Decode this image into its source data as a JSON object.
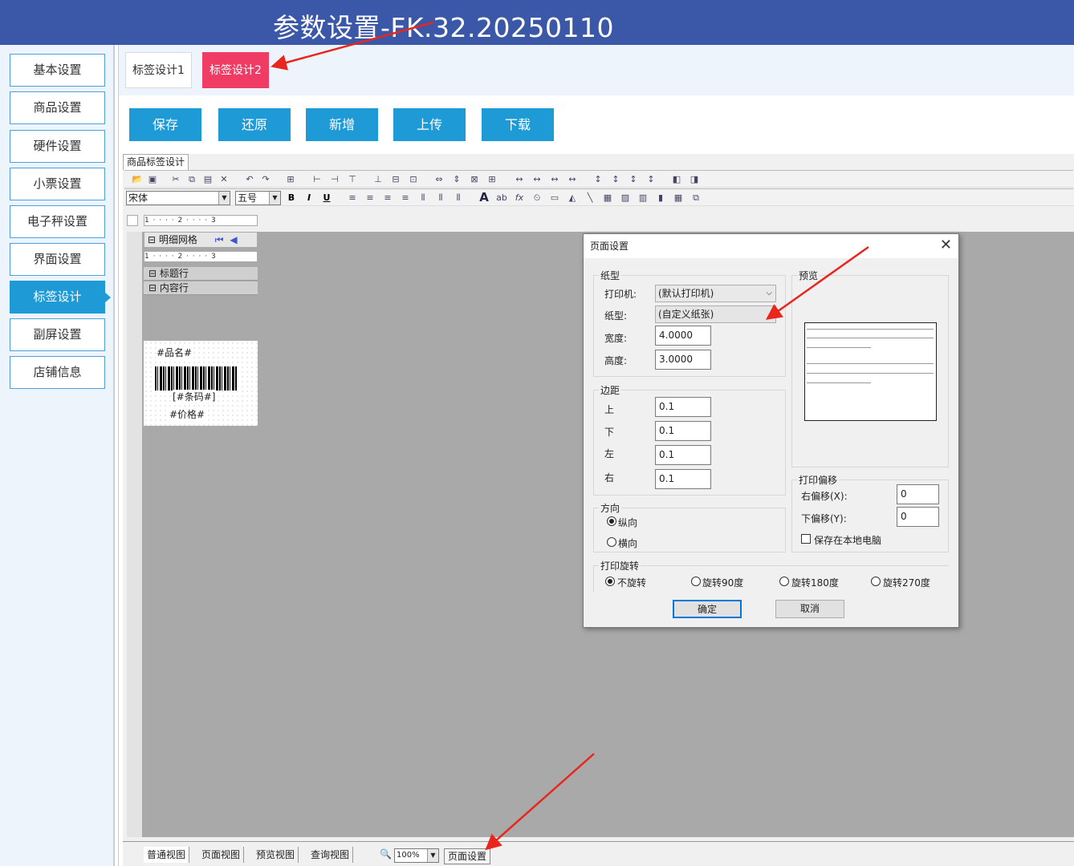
{
  "window": {
    "title": "参数设置-FK.32.20250110"
  },
  "sidebar": {
    "items": [
      "基本设置",
      "商品设置",
      "硬件设置",
      "小票设置",
      "电子秤设置",
      "界面设置",
      "标签设计",
      "副屏设置",
      "店铺信息"
    ],
    "active_index": 6
  },
  "tabs": [
    "标签设计1",
    "标签设计2"
  ],
  "buttons": {
    "save": "保存",
    "restore": "还原",
    "add": "新增",
    "upload": "上传",
    "download": "下载"
  },
  "designer": {
    "tab": "商品标签设计",
    "font_name": "宋体",
    "font_size": "五号",
    "bold": "B",
    "italic": "I",
    "underline": "U",
    "ruler": "1 · · · · 2 · · · · 3",
    "grid_title": "明细网格",
    "band_title": "标题行",
    "band_content": "内容行",
    "label_fields": {
      "name": "#品名#",
      "barcode": "[#条码#]",
      "price": "#价格#"
    }
  },
  "statusbar": {
    "views": [
      "普通视图",
      "页面视图",
      "预览视图",
      "查询视图"
    ],
    "zoom": "100%",
    "page_setup": "页面设置"
  },
  "dialog": {
    "title": "页面设置",
    "close": "✕",
    "paper": {
      "group": "纸型",
      "printer_label": "打印机:",
      "printer_value": "(默认打印机)",
      "paper_label": "纸型:",
      "paper_value": "(自定义纸张)",
      "width_label": "宽度:",
      "width_value": "4.0000",
      "height_label": "高度:",
      "height_value": "3.0000"
    },
    "margins": {
      "group": "边距",
      "top_label": "上",
      "top": "0.1",
      "bottom_label": "下",
      "bottom": "0.1",
      "left_label": "左",
      "left": "0.1",
      "right_label": "右",
      "right": "0.1"
    },
    "orientation": {
      "group": "方向",
      "portrait": "纵向",
      "landscape": "横向",
      "selected": "portrait"
    },
    "preview": {
      "group": "预览"
    },
    "offset": {
      "group": "打印偏移",
      "right_label": "右偏移(X):",
      "right_value": "0",
      "down_label": "下偏移(Y):",
      "down_value": "0",
      "save_local": "保存在本地电脑",
      "save_local_checked": false
    },
    "rotation": {
      "group": "打印旋转",
      "options": [
        "不旋转",
        "旋转90度",
        "旋转180度",
        "旋转270度"
      ],
      "selected_index": 0
    },
    "ok": "确定",
    "cancel": "取消"
  },
  "colors": {
    "titlebar": "#3b57a8",
    "accent": "#1e9ad6",
    "active_tab": "#f03c64",
    "annotation_arrow": "#e8261e",
    "canvas": "#a9a9a9"
  }
}
